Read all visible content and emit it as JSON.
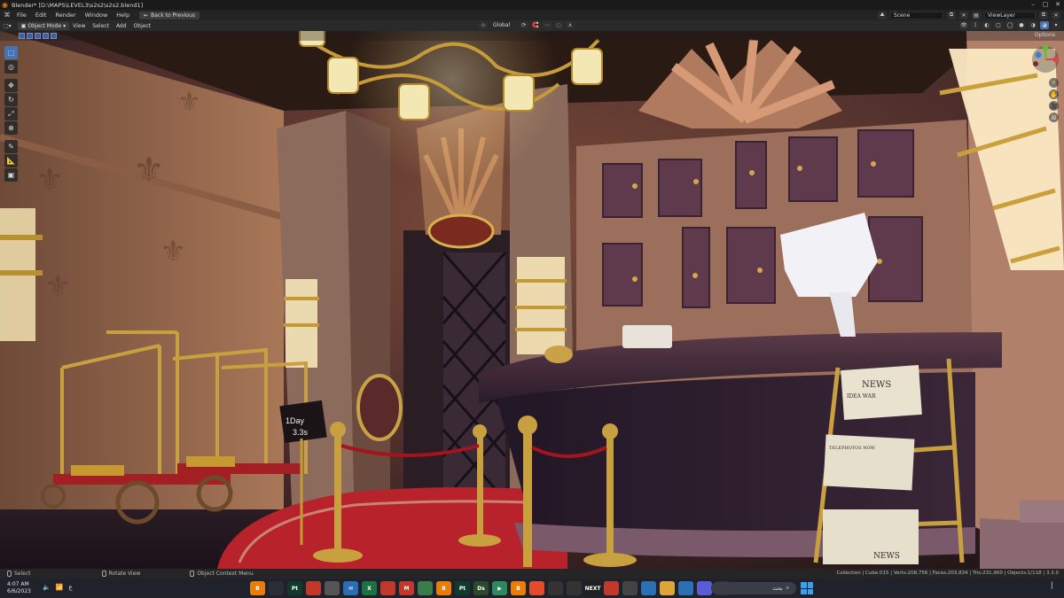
{
  "window": {
    "title": "Blender* [D:\\MAPS\\LEVEL3\\s2s2\\s2s2.blend1]",
    "controls": [
      "–",
      "▢",
      "✕"
    ]
  },
  "menubar": {
    "items": [
      "File",
      "Edit",
      "Render",
      "Window",
      "Help"
    ],
    "back_button": "Back to Previous",
    "scene_label": "Scene",
    "view_layer_label": "ViewLayer"
  },
  "viewport_header": {
    "mode": "Object Mode",
    "items": [
      "View",
      "Select",
      "Add",
      "Object"
    ],
    "orientation": "Global",
    "options_label": "Options"
  },
  "toolbar": {
    "tools": [
      {
        "name": "select-box",
        "glyph": "⬚",
        "active": true
      },
      {
        "name": "cursor",
        "glyph": "◎",
        "active": false
      },
      {
        "name": "move",
        "glyph": "✥",
        "active": false
      },
      {
        "name": "rotate",
        "glyph": "↻",
        "active": false
      },
      {
        "name": "scale",
        "glyph": "⤢",
        "active": false
      },
      {
        "name": "transform",
        "glyph": "⊕",
        "active": false
      },
      {
        "name": "annotate",
        "glyph": "✎",
        "active": false
      },
      {
        "name": "measure",
        "glyph": "📐",
        "active": false
      },
      {
        "name": "add-cube",
        "glyph": "▣",
        "active": false
      }
    ]
  },
  "scene": {
    "sign_line1": "1Day",
    "sign_line2": "3.3s",
    "newspaper_headline": "NEWS",
    "newspaper_sub": "IDEA WAR",
    "newspaper_lower": "TELEPHOTOS NOW",
    "newspaper_bottom": "NEWS"
  },
  "statusbar": {
    "select": "Select",
    "rotate": "Rotate View",
    "context": "Object Context Menu",
    "stats": "Collection | Cube.015 | Verts:208,756 | Faces:203,834 | Tris:231,960 | Objects:1/118 | 3.3.0"
  },
  "taskbar": {
    "time": "4:07 AM",
    "date": "6/6/2023",
    "search_text": "بحث",
    "apps": [
      {
        "label": "B",
        "color": "#e87d0d"
      },
      {
        "label": "",
        "color": "#2b2d36"
      },
      {
        "label": "Pt",
        "color": "#0f3b2c"
      },
      {
        "label": "",
        "color": "#c0392b"
      },
      {
        "label": "",
        "color": "#555555"
      },
      {
        "label": "✉",
        "color": "#2a6fb5"
      },
      {
        "label": "X",
        "color": "#1e7145"
      },
      {
        "label": "",
        "color": "#c0392b"
      },
      {
        "label": "M",
        "color": "#c0392b"
      },
      {
        "label": "",
        "color": "#3a7c4a"
      },
      {
        "label": "B",
        "color": "#e87d0d"
      },
      {
        "label": "Pt",
        "color": "#0f3b2c"
      },
      {
        "label": "Ds",
        "color": "#2a4a2a"
      },
      {
        "label": "▶",
        "color": "#2d8a5a"
      },
      {
        "label": "B",
        "color": "#e87d0d"
      },
      {
        "label": "",
        "color": "#e24b2c"
      },
      {
        "label": "",
        "color": "#333333"
      },
      {
        "label": "",
        "color": "#333333"
      },
      {
        "label": "NEXT",
        "color": "#202020"
      },
      {
        "label": "",
        "color": "#c0392b"
      },
      {
        "label": "",
        "color": "#444444"
      },
      {
        "label": "",
        "color": "#2b6fb5"
      },
      {
        "label": "",
        "color": "#e0a43a"
      },
      {
        "label": "",
        "color": "#2b6fb5"
      },
      {
        "label": "",
        "color": "#5a5bd6"
      },
      {
        "label": "",
        "color": "#333333"
      }
    ]
  },
  "colors": {
    "accent": "#4772b3",
    "blender_orange": "#e87d0d"
  }
}
